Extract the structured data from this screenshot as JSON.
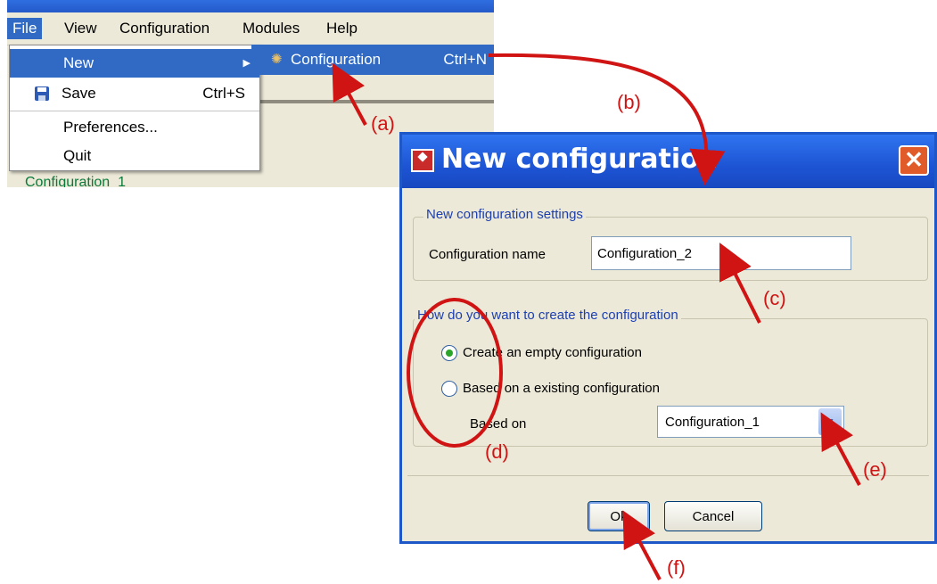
{
  "menubar": {
    "items": [
      "File",
      "View",
      "Configuration",
      "Modules",
      "Help"
    ]
  },
  "file_menu": {
    "new_label": "New",
    "save_label": "Save",
    "save_shortcut": "Ctrl+S",
    "preferences_label": "Preferences...",
    "quit_label": "Quit"
  },
  "submenu": {
    "configuration_label": "Configuration",
    "configuration_shortcut": "Ctrl+N"
  },
  "background": {
    "status_text": "Configuration_1"
  },
  "dialog": {
    "title": "New configuration",
    "close_symbol": "✕",
    "settings_legend": "New configuration settings",
    "config_name_label": "Configuration name",
    "config_name_value": "Configuration_2",
    "create_legend": "How do you want to create the configuration",
    "radio_empty_label": "Create an empty configuration",
    "radio_based_label": "Based on a existing configuration",
    "selected_option": "empty",
    "based_on_label": "Based on",
    "based_on_value": "Configuration_1",
    "ok_label": "Ok",
    "cancel_label": "Cancel"
  },
  "annotations": [
    "(a)",
    "(b)",
    "(c)",
    "(d)",
    "(e)",
    "(f)"
  ],
  "colors": {
    "highlight": "#316ac5",
    "annotation": "#d01414",
    "title_bar": "#1d54d4"
  }
}
